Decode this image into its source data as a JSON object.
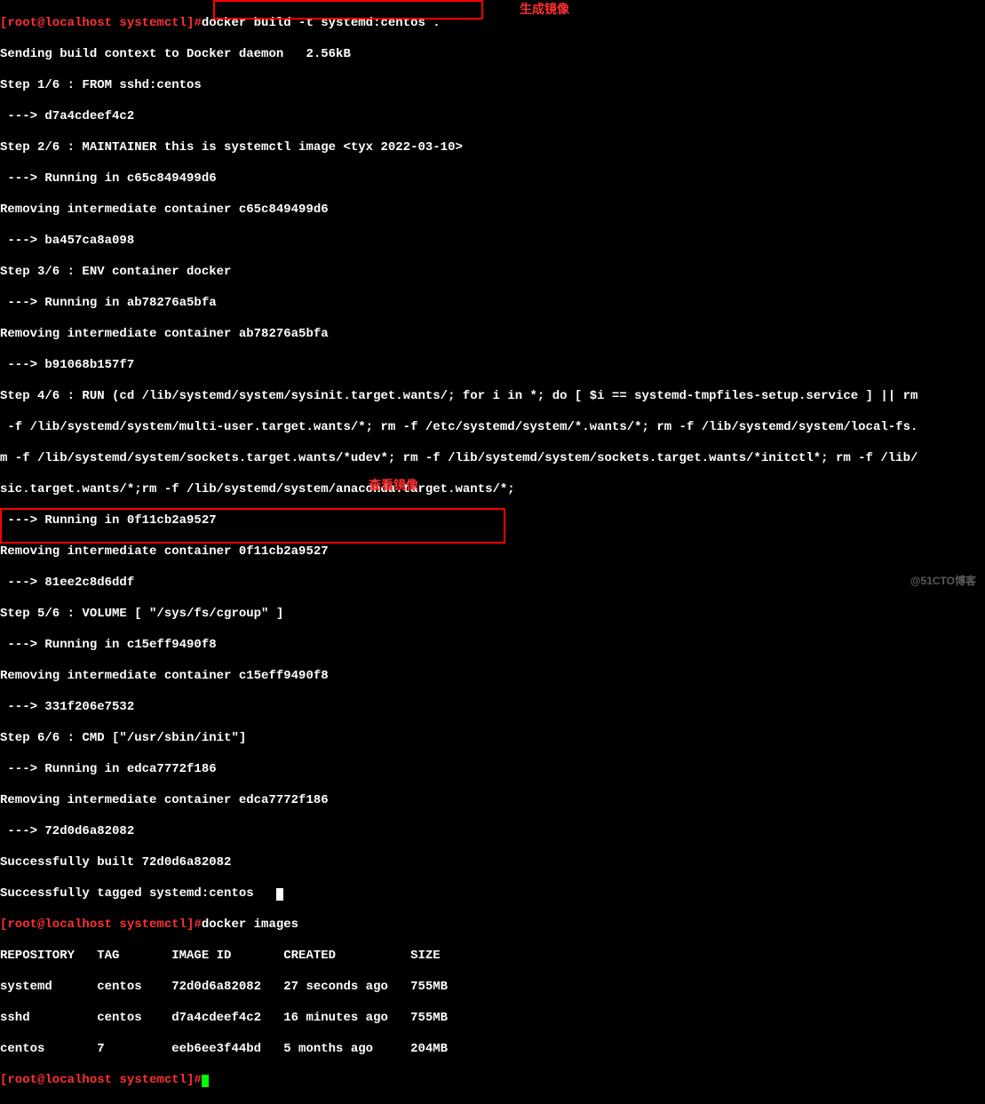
{
  "prompt": {
    "user_host": "[root@localhost systemctl]",
    "hash": "#"
  },
  "commands": {
    "build": "docker build -t systemd:centos .",
    "images": "docker images"
  },
  "annotations": {
    "build": "生成镜像",
    "images": "查看镜像"
  },
  "build_output": {
    "l1": "Sending build context to Docker daemon   2.56kB",
    "l2": "Step 1/6 : FROM sshd:centos",
    "l3": " ---> d7a4cdeef4c2",
    "l4": "Step 2/6 : MAINTAINER this is systemctl image <tyx 2022-03-10>",
    "l5": " ---> Running in c65c849499d6",
    "l6": "Removing intermediate container c65c849499d6",
    "l7": " ---> ba457ca8a098",
    "l8": "Step 3/6 : ENV container docker",
    "l9": " ---> Running in ab78276a5bfa",
    "l10": "Removing intermediate container ab78276a5bfa",
    "l11": " ---> b91068b157f7",
    "l12": "Step 4/6 : RUN (cd /lib/systemd/system/sysinit.target.wants/; for i in *; do [ $i == systemd-tmpfiles-setup.service ] || rm",
    "l12b": " -f /lib/systemd/system/multi-user.target.wants/*; rm -f /etc/systemd/system/*.wants/*; rm -f /lib/systemd/system/local-fs.",
    "l12c": "m -f /lib/systemd/system/sockets.target.wants/*udev*; rm -f /lib/systemd/system/sockets.target.wants/*initctl*; rm -f /lib/",
    "l12d": "sic.target.wants/*;rm -f /lib/systemd/system/anaconda.target.wants/*;",
    "l13": " ---> Running in 0f11cb2a9527",
    "l14": "Removing intermediate container 0f11cb2a9527",
    "l15": " ---> 81ee2c8d6ddf",
    "l16": "Step 5/6 : VOLUME [ \"/sys/fs/cgroup\" ]",
    "l17": " ---> Running in c15eff9490f8",
    "l18": "Removing intermediate container c15eff9490f8",
    "l19": " ---> 331f206e7532",
    "l20": "Step 6/6 : CMD [\"/usr/sbin/init\"]",
    "l21": " ---> Running in edca7772f186",
    "l22": "Removing intermediate container edca7772f186",
    "l23": " ---> 72d0d6a82082",
    "l24": "Successfully built 72d0d6a82082",
    "l25": "Successfully tagged systemd:centos"
  },
  "images_table": {
    "header": "REPOSITORY   TAG       IMAGE ID       CREATED          SIZE",
    "rows": [
      "systemd      centos    72d0d6a82082   27 seconds ago   755MB",
      "sshd         centos    d7a4cdeef4c2   16 minutes ago   755MB",
      "centos       7         eeb6ee3f44bd   5 months ago     204MB"
    ]
  },
  "chart_data": {
    "type": "table",
    "title": "docker images",
    "columns": [
      "REPOSITORY",
      "TAG",
      "IMAGE ID",
      "CREATED",
      "SIZE"
    ],
    "rows": [
      [
        "systemd",
        "centos",
        "72d0d6a82082",
        "27 seconds ago",
        "755MB"
      ],
      [
        "sshd",
        "centos",
        "d7a4cdeef4c2",
        "16 minutes ago",
        "755MB"
      ],
      [
        "centos",
        "7",
        "eeb6ee3f44bd",
        "5 months ago",
        "204MB"
      ]
    ]
  },
  "watermark": "@51CTO博客"
}
